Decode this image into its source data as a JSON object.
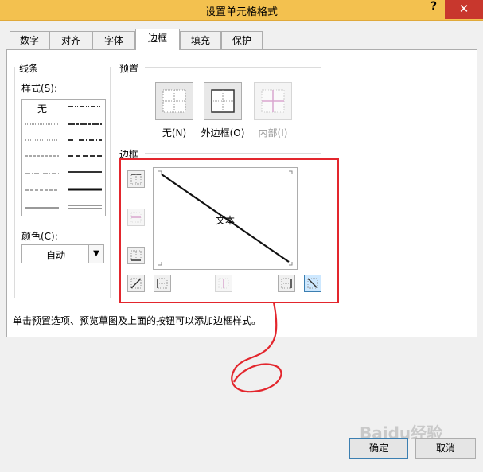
{
  "window": {
    "title": "设置单元格格式",
    "help": "?",
    "close": "✕"
  },
  "tabs": [
    {
      "label": "数字"
    },
    {
      "label": "对齐"
    },
    {
      "label": "字体"
    },
    {
      "label": "边框"
    },
    {
      "label": "填充"
    },
    {
      "label": "保护"
    }
  ],
  "active_tab": "边框",
  "line_group": {
    "title": "线条",
    "style_label": "样式(S):",
    "none_label": "无",
    "color_label": "颜色(C):",
    "color_value": "自动"
  },
  "preset_group": {
    "title": "预置",
    "presets": [
      {
        "label": "无(N)"
      },
      {
        "label": "外边框(O)"
      },
      {
        "label": "内部(I)"
      }
    ]
  },
  "border_group": {
    "title": "边框",
    "preview_text": "文本"
  },
  "hint": "单击预置选项、预览草图及上面的按钮可以添加边框样式。",
  "buttons": {
    "ok": "确定",
    "cancel": "取消"
  },
  "watermark": "Baidu经验",
  "colors": {
    "titlebar": "#f3c14f",
    "close": "#c8372d",
    "annotation": "#e3262d",
    "selected": "#cde8ff"
  }
}
